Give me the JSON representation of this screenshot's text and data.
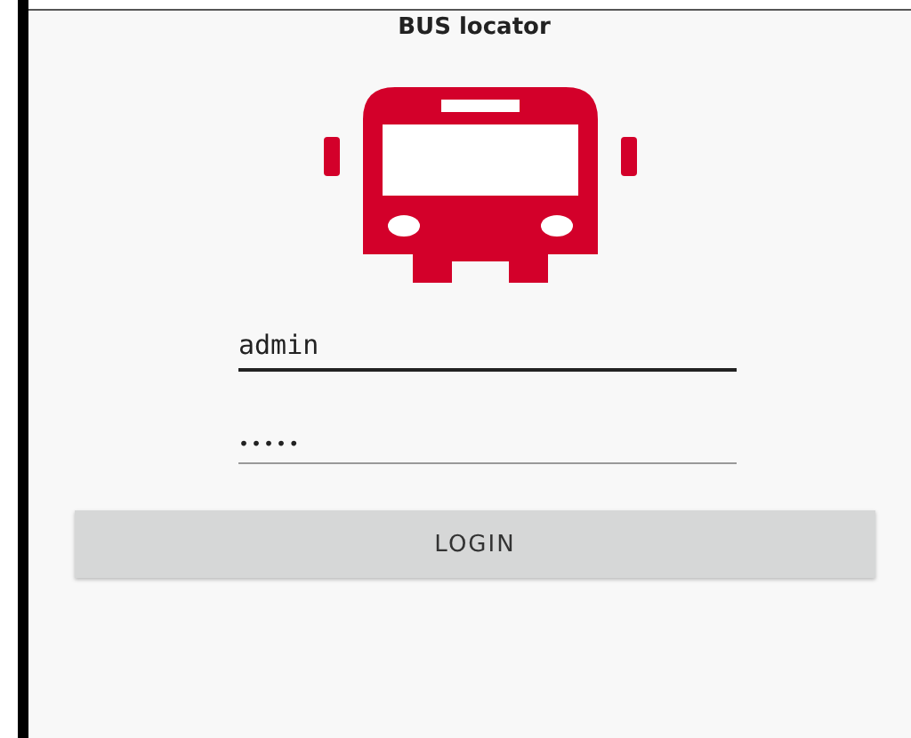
{
  "app_bar": {
    "title": "BUS locator"
  },
  "fields": [
    {
      "kind": "text",
      "value": "admin",
      "focused": true
    },
    {
      "kind": "password",
      "value": "•••••",
      "focused": false
    }
  ],
  "login_button": {
    "label": "LOGIN"
  }
}
